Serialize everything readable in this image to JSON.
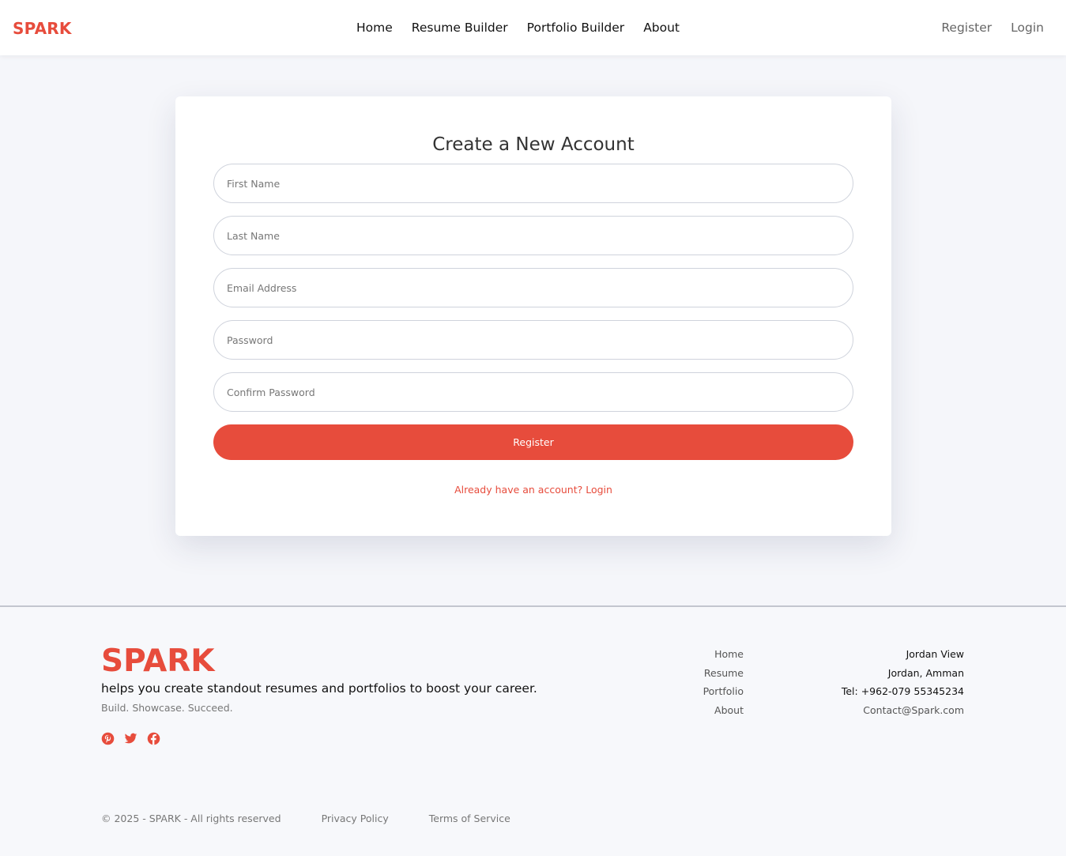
{
  "header": {
    "brand": "SPARK",
    "nav": [
      "Home",
      "Resume Builder",
      "Portfolio Builder",
      "About"
    ],
    "auth": [
      "Register",
      "Login"
    ]
  },
  "form": {
    "title": "Create a New Account",
    "fields": [
      {
        "placeholder": "First Name",
        "value": ""
      },
      {
        "placeholder": "Last Name",
        "value": ""
      },
      {
        "placeholder": "Email Address",
        "value": ""
      },
      {
        "placeholder": "Password",
        "value": ""
      },
      {
        "placeholder": "Confirm Password",
        "value": ""
      }
    ],
    "submit_label": "Register",
    "login_link": "Already have an account? Login"
  },
  "footer": {
    "brand": "SPARK",
    "tagline": "helps you create standout resumes and portfolios to boost your career.",
    "motto": "Build. Showcase. Succeed.",
    "socials": [
      "pinterest-icon",
      "twitter-icon",
      "facebook-icon"
    ],
    "links": [
      "Home",
      "Resume",
      "Portfolio",
      "About"
    ],
    "contact": {
      "line1": "Jordan View",
      "line2": "Jordan, Amman",
      "phone": "Tel: +962-079 55345234",
      "email": "Contact@Spark.com"
    },
    "copyright": "© 2025 - SPARK - All rights reserved",
    "privacy": "Privacy Policy",
    "terms": "Terms of Service"
  },
  "colors": {
    "accent": "#e74c3c",
    "background": "#f5f6fa"
  }
}
